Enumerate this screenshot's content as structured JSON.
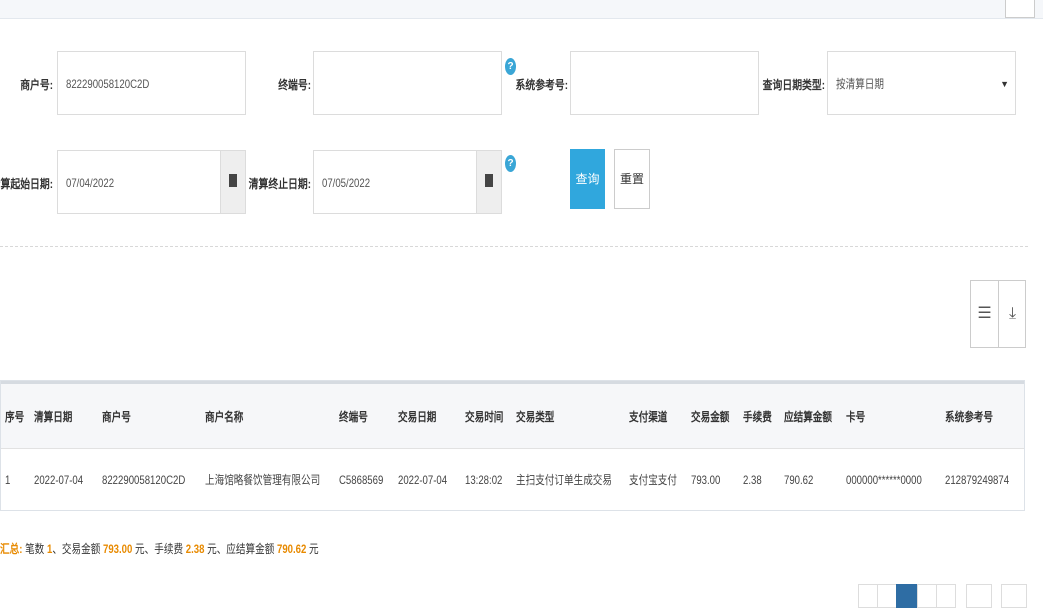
{
  "search": {
    "merchant_label": "商户号:",
    "merchant_value": "822290058120C2D",
    "terminal_label": "终端号:",
    "terminal_value": "",
    "sysref_label": "系统参考号:",
    "sysref_value": "",
    "date_type_label": "查询日期类型:",
    "date_type_value": "按清算日期",
    "start_label": "清算起始日期:",
    "start_value": "07/04/2022",
    "end_label": "清算终止日期:",
    "end_value": "07/05/2022",
    "query_label": "查询",
    "reset_label": "重置",
    "help_glyph": "?"
  },
  "table": {
    "headers": [
      "序号",
      "清算日期",
      "商户号",
      "商户名称",
      "终端号",
      "交易日期",
      "交易时间",
      "交易类型",
      "支付渠道",
      "交易金额",
      "手续费",
      "应结算金额",
      "卡号",
      "系统参考号"
    ],
    "rows": [
      [
        "1",
        "2022-07-04",
        "822290058120C2D",
        "上海馆略餐饮管理有限公司",
        "C5868569",
        "2022-07-04",
        "13:28:02",
        "主扫支付订单生成交易",
        "支付宝支付",
        "793.00",
        "2.38",
        "790.62",
        "000000******0000",
        "212879249874"
      ]
    ]
  },
  "summary": {
    "prefix": "汇总:",
    "count_label": "笔数",
    "count": "1",
    "amount_label": "、交易金额",
    "amount": "793.00",
    "fee_label": "元、手续费",
    "fee": "2.38",
    "settle_label": "元、应结算金额",
    "settle": "790.62",
    "unit": "元"
  },
  "colors": {
    "accent": "#30a7dd",
    "summary_highlight": "#e88a00",
    "pager_active": "#2e6da4"
  }
}
